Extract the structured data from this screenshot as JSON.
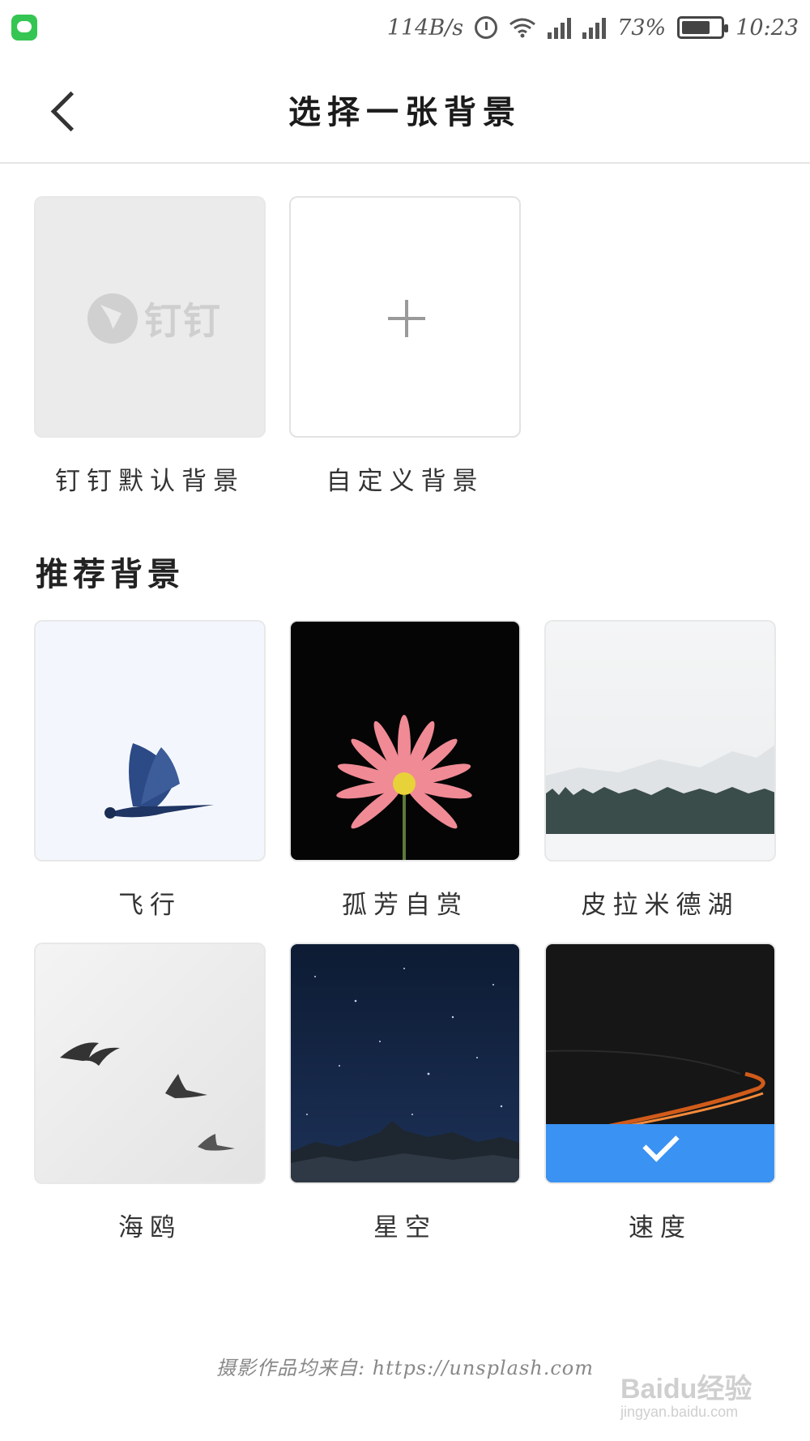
{
  "status_bar": {
    "net_speed": "114B/s",
    "battery": "73%",
    "battery_level": 0.73,
    "time": "10:23",
    "icons": [
      "chat-app-icon",
      "alarm-icon",
      "wifi-icon",
      "signal-icon",
      "battery-icon"
    ]
  },
  "header": {
    "title": "选择一张背景"
  },
  "top_tiles": {
    "default": {
      "label": "钉钉默认背景",
      "logo_text": "钉钉"
    },
    "custom": {
      "label": "自定义背景"
    }
  },
  "section": {
    "title": "推荐背景"
  },
  "backgrounds": [
    {
      "label": "飞行",
      "selected": false
    },
    {
      "label": "孤芳自赏",
      "selected": false
    },
    {
      "label": "皮拉米德湖",
      "selected": false
    },
    {
      "label": "海鸥",
      "selected": false
    },
    {
      "label": "星空",
      "selected": false
    },
    {
      "label": "速度",
      "selected": true
    }
  ],
  "footer": {
    "credit": "摄影作品均来自: https://unsplash.com"
  },
  "watermark": {
    "main": "Baidu经验",
    "sub": "jingyan.baidu.com"
  },
  "colors": {
    "accent": "#3a92f2",
    "status_green": "#35c553"
  }
}
